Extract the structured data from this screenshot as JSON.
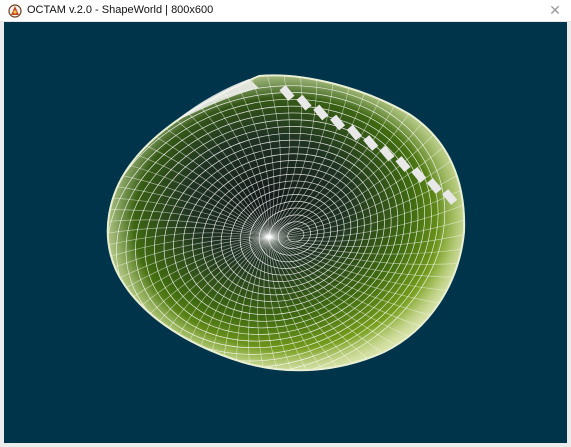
{
  "window": {
    "title": "OCTAM v.2.0 - ShapeWorld | 800x600",
    "close_glyph": "✕",
    "app_icon": "octam-logo-icon"
  },
  "scene": {
    "background_color": "#00344a",
    "mesh_color": "#ffffff",
    "fill_colors": [
      "#3f6a10",
      "#7aa11e",
      "#c9d87a",
      "#151a1a"
    ],
    "highlight_strip_color": "#e8e8e8"
  }
}
